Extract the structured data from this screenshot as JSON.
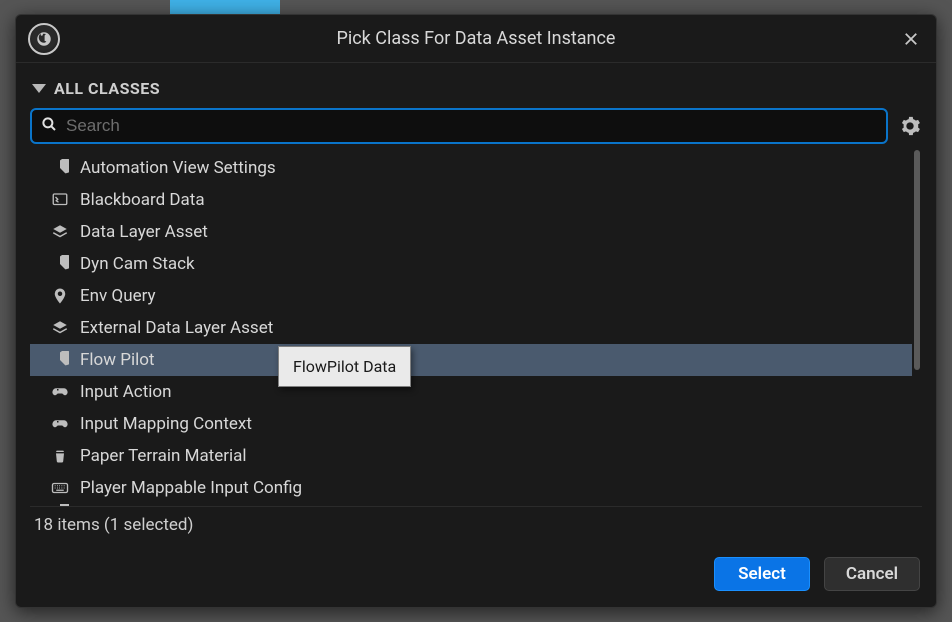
{
  "dialog": {
    "title": "Pick Class For Data Asset Instance",
    "section_label": "ALL CLASSES"
  },
  "search": {
    "placeholder": "Search",
    "value": ""
  },
  "list": {
    "items": [
      {
        "label": "Automation View Settings",
        "icon": "pie-icon",
        "selected": false
      },
      {
        "label": "Blackboard Data",
        "icon": "board-icon",
        "selected": false
      },
      {
        "label": "Data Layer Asset",
        "icon": "layers-icon",
        "selected": false
      },
      {
        "label": "Dyn Cam Stack",
        "icon": "pie-icon",
        "selected": false
      },
      {
        "label": "Env Query",
        "icon": "pin-icon",
        "selected": false
      },
      {
        "label": "External Data Layer Asset",
        "icon": "layers-icon",
        "selected": false
      },
      {
        "label": "Flow Pilot",
        "icon": "pie-icon",
        "selected": true
      },
      {
        "label": "Input Action",
        "icon": "gamepad-icon",
        "selected": false
      },
      {
        "label": "Input Mapping Context",
        "icon": "gamepad-icon",
        "selected": false
      },
      {
        "label": "Paper Terrain Material",
        "icon": "trash-icon",
        "selected": false
      },
      {
        "label": "Player Mappable Input Config",
        "icon": "keyboard-icon",
        "selected": false
      },
      {
        "label": "",
        "icon": "pie-icon",
        "selected": false,
        "cutoff": true
      }
    ],
    "total_items": 18,
    "selected_count": 1
  },
  "tooltip": {
    "text": "FlowPilot Data"
  },
  "status": {
    "text": "18 items (1 selected)"
  },
  "buttons": {
    "select": "Select",
    "cancel": "Cancel"
  }
}
